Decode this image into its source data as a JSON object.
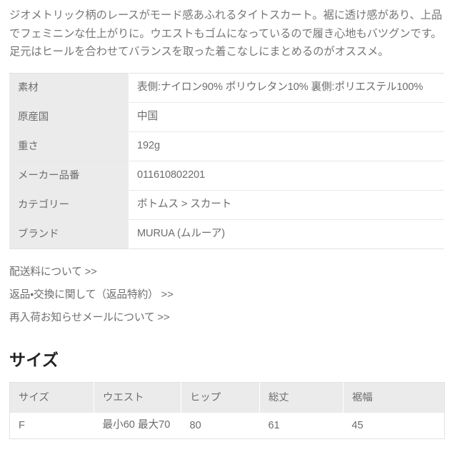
{
  "product_description": "ジオメトリック柄のレースがモード感あふれるタイトスカート。裾に透け感があり、上品でフェミニンな仕上がりに。ウエストもゴムになっているので履き心地もバツグンです。足元はヒールを合わせてバランスを取った着こなしにまとめるのがオススメ。",
  "spec_table": {
    "rows": [
      {
        "label": "素材",
        "value": "表側:ナイロン90% ポリウレタン10% 裏側:ポリエステル100%"
      },
      {
        "label": "原産国",
        "value": "中国"
      },
      {
        "label": "重さ",
        "value": "192g"
      },
      {
        "label": "メーカー品番",
        "value": "011610802201"
      },
      {
        "label": "カテゴリー",
        "value": "ボトムス > スカート"
      },
      {
        "label": "ブランド",
        "value": "MURUA (ムルーア)"
      }
    ]
  },
  "links": [
    {
      "label": "配送料について >>"
    },
    {
      "label": "返品・交換に関して（返品特約） >>"
    },
    {
      "label": "再入荷お知らせメールについて >>"
    }
  ],
  "size_section": {
    "heading": "サイズ",
    "columns": [
      "サイズ",
      "ウエスト",
      "ヒップ",
      "総丈",
      "裾幅"
    ],
    "rows": [
      {
        "size": "F",
        "waist": "最小60 最大70",
        "hip": "80",
        "length": "61",
        "hem": "45"
      }
    ]
  },
  "colors": {
    "header_bg": "#ebebeb",
    "body_bg": "#ffffff",
    "text": "#6d6d6d",
    "heading_text": "#222222",
    "border": "#e2e2e2"
  }
}
